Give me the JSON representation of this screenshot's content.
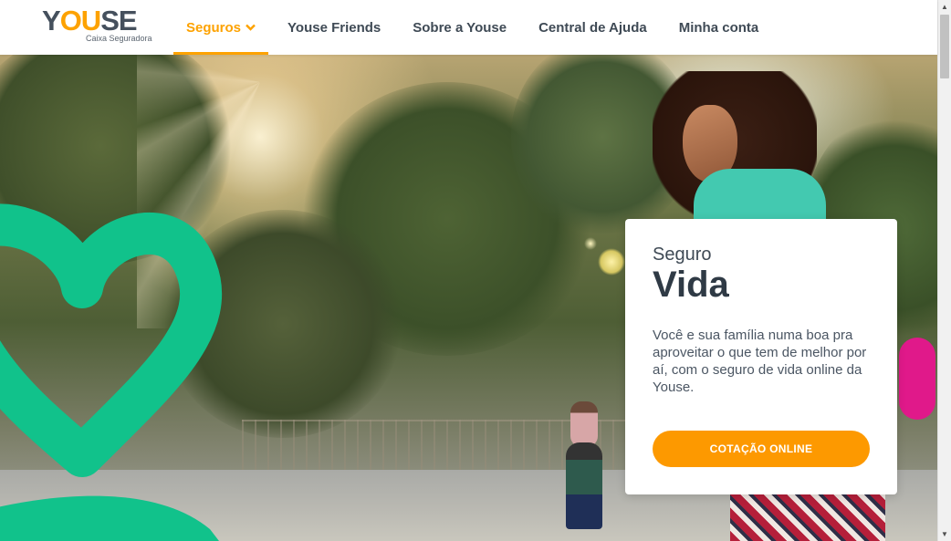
{
  "header": {
    "logo": {
      "word_main": "Y",
      "word_accent": "OU",
      "word_rest": "SE",
      "subtitle": "Caixa Seguradora"
    },
    "nav": [
      {
        "label": "Seguros",
        "active": true,
        "has_dropdown": true
      },
      {
        "label": "Youse Friends",
        "active": false
      },
      {
        "label": "Sobre a Youse",
        "active": false
      },
      {
        "label": "Central de Ajuda",
        "active": false
      },
      {
        "label": "Minha conta",
        "active": false
      }
    ]
  },
  "hero": {
    "card": {
      "eyebrow": "Seguro",
      "title": "Vida",
      "description": "Você e sua família numa boa pra aproveitar o que tem de melhor por aí, com o seguro de vida online da Youse.",
      "cta_label": "COTAÇÃO ONLINE"
    },
    "decor_icon": "heart-outline-icon"
  },
  "colors": {
    "brand_orange": "#fd9900",
    "brand_dark": "#3f4a55",
    "heart_green": "#11c28b"
  }
}
